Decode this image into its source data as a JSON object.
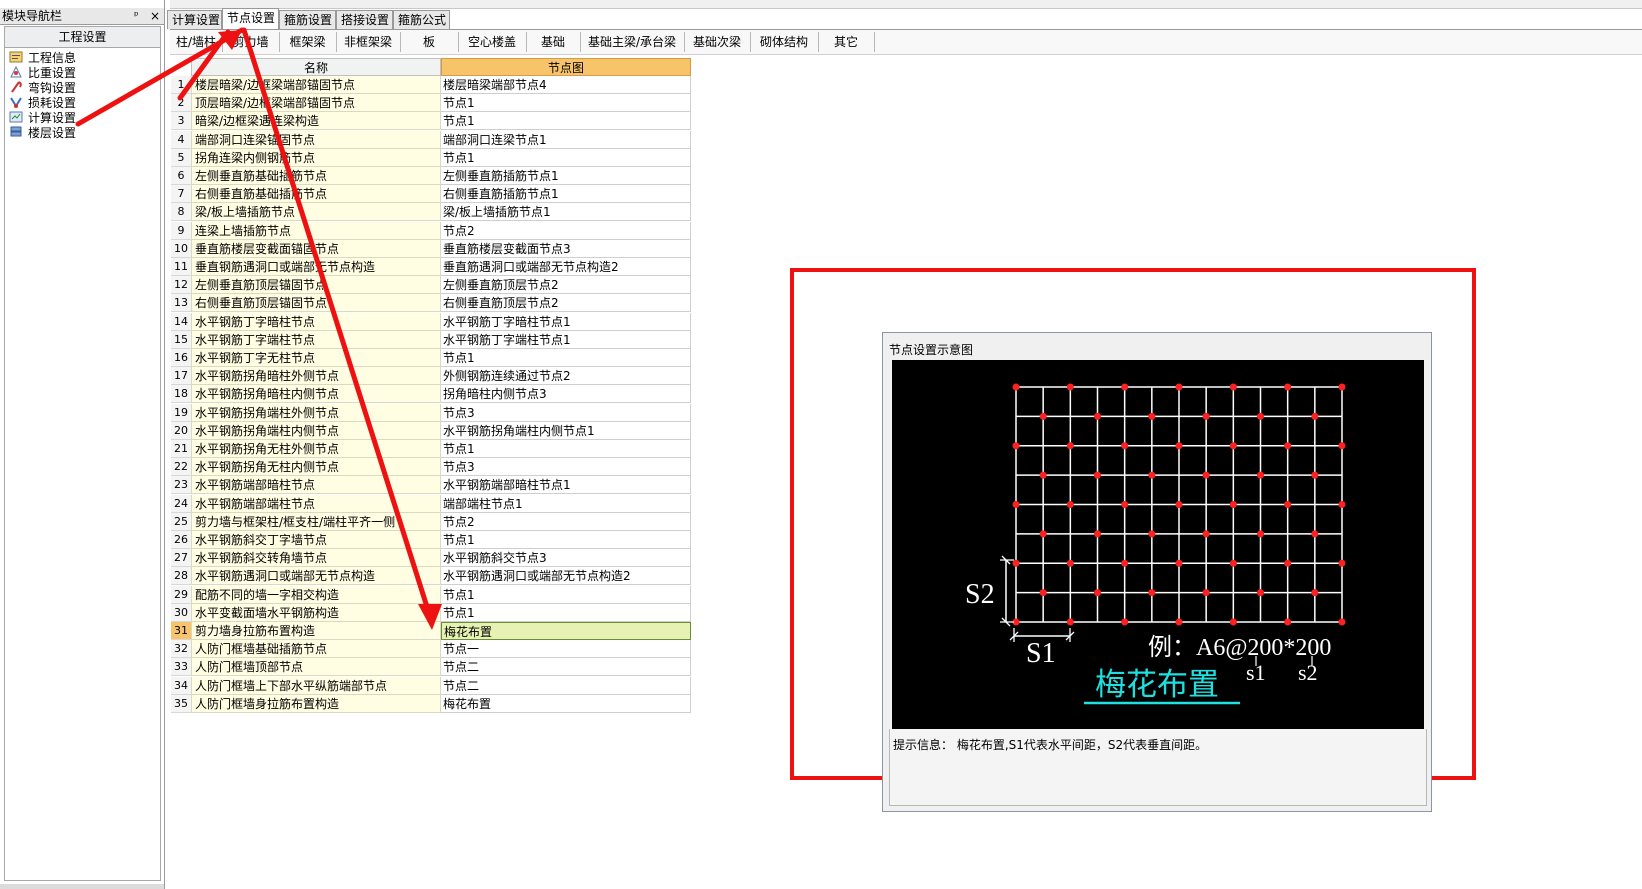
{
  "nav": {
    "title": "模块导航栏",
    "pin": "ᵖ",
    "close": "×",
    "group": "工程设置",
    "items": [
      {
        "label": "工程信息",
        "icon": "info-icon"
      },
      {
        "label": "比重设置",
        "icon": "weight-icon"
      },
      {
        "label": "弯钩设置",
        "icon": "hook-icon"
      },
      {
        "label": "损耗设置",
        "icon": "loss-icon"
      },
      {
        "label": "计算设置",
        "icon": "calc-icon"
      },
      {
        "label": "楼层设置",
        "icon": "floor-icon"
      }
    ]
  },
  "tabs": [
    "计算设置",
    "节点设置",
    "箍筋设置",
    "搭接设置",
    "箍筋公式"
  ],
  "active_tab": "节点设置",
  "subtabs": [
    "柱/墙柱",
    "剪力墙",
    "框架梁",
    "非框架梁",
    "板",
    "空心楼盖",
    "基础",
    "基础主梁/承台梁",
    "基础次梁",
    "砌体结构",
    "其它"
  ],
  "grid": {
    "headers": {
      "name": "名称",
      "node": "节点图"
    },
    "rows": [
      {
        "n": "1",
        "name": "楼层暗梁/边框梁端部锚固节点",
        "node": "楼层暗梁端部节点4"
      },
      {
        "n": "2",
        "name": "顶层暗梁/边框梁端部锚固节点",
        "node": "节点1"
      },
      {
        "n": "3",
        "name": "暗梁/边框梁遇连梁构造",
        "node": "节点1"
      },
      {
        "n": "4",
        "name": "端部洞口连梁锚固节点",
        "node": "端部洞口连梁节点1"
      },
      {
        "n": "5",
        "name": "拐角连梁内侧钢筋节点",
        "node": "节点1"
      },
      {
        "n": "6",
        "name": "左侧垂直筋基础插筋节点",
        "node": "左侧垂直筋插筋节点1"
      },
      {
        "n": "7",
        "name": "右侧垂直筋基础插筋节点",
        "node": "右侧垂直筋插筋节点1"
      },
      {
        "n": "8",
        "name": "梁/板上墙插筋节点",
        "node": "梁/板上墙插筋节点1"
      },
      {
        "n": "9",
        "name": "连梁上墙插筋节点",
        "node": "节点2"
      },
      {
        "n": "10",
        "name": "垂直筋楼层变截面锚固节点",
        "node": "垂直筋楼层变截面节点3"
      },
      {
        "n": "11",
        "name": "垂直钢筋遇洞口或端部无节点构造",
        "node": "垂直筋遇洞口或端部无节点构造2"
      },
      {
        "n": "12",
        "name": "左侧垂直筋顶层锚固节点",
        "node": "左侧垂直筋顶层节点2"
      },
      {
        "n": "13",
        "name": "右侧垂直筋顶层锚固节点",
        "node": "右侧垂直筋顶层节点2"
      },
      {
        "n": "14",
        "name": "水平钢筋丁字暗柱节点",
        "node": "水平钢筋丁字暗柱节点1"
      },
      {
        "n": "15",
        "name": "水平钢筋丁字端柱节点",
        "node": "水平钢筋丁字端柱节点1"
      },
      {
        "n": "16",
        "name": "水平钢筋丁字无柱节点",
        "node": "节点1"
      },
      {
        "n": "17",
        "name": "水平钢筋拐角暗柱外侧节点",
        "node": "外侧钢筋连续通过节点2"
      },
      {
        "n": "18",
        "name": "水平钢筋拐角暗柱内侧节点",
        "node": "拐角暗柱内侧节点3"
      },
      {
        "n": "19",
        "name": "水平钢筋拐角端柱外侧节点",
        "node": "节点3"
      },
      {
        "n": "20",
        "name": "水平钢筋拐角端柱内侧节点",
        "node": "水平钢筋拐角端柱内侧节点1"
      },
      {
        "n": "21",
        "name": "水平钢筋拐角无柱外侧节点",
        "node": "节点1"
      },
      {
        "n": "22",
        "name": "水平钢筋拐角无柱内侧节点",
        "node": "节点3"
      },
      {
        "n": "23",
        "name": "水平钢筋端部暗柱节点",
        "node": "水平钢筋端部暗柱节点1"
      },
      {
        "n": "24",
        "name": "水平钢筋端部端柱节点",
        "node": "端部端柱节点1"
      },
      {
        "n": "25",
        "name": "剪力墙与框架柱/框支柱/端柱平齐一侧",
        "node": "节点2"
      },
      {
        "n": "26",
        "name": "水平钢筋斜交丁字墙节点",
        "node": "节点1"
      },
      {
        "n": "27",
        "name": "水平钢筋斜交转角墙节点",
        "node": "水平钢筋斜交节点3"
      },
      {
        "n": "28",
        "name": "水平钢筋遇洞口或端部无节点构造",
        "node": "水平钢筋遇洞口或端部无节点构造2"
      },
      {
        "n": "29",
        "name": "配筋不同的墙一字相交构造",
        "node": "节点1"
      },
      {
        "n": "30",
        "name": "水平变截面墙水平钢筋构造",
        "node": "节点1"
      },
      {
        "n": "31",
        "name": "剪力墙身拉筋布置构造",
        "node": "梅花布置"
      },
      {
        "n": "32",
        "name": "人防门框墙基础插筋节点",
        "node": "节点一"
      },
      {
        "n": "33",
        "name": "人防门框墙顶部节点",
        "node": "节点二"
      },
      {
        "n": "34",
        "name": "人防门框墙上下部水平纵筋端部节点",
        "node": "节点二"
      },
      {
        "n": "35",
        "name": "人防门框墙身拉筋布置构造",
        "node": "梅花布置"
      }
    ],
    "selected_row": "31"
  },
  "panel": {
    "title": "节点设置示意图",
    "diagram": {
      "s2_label": "S2",
      "s1_label": "S1",
      "example": "例：A6@200*200",
      "s1_small": "s1",
      "s2_small": "s2",
      "pattern_label": "梅花布置"
    },
    "hint": "提示信息：  梅花布置,S1代表水平间距，S2代表垂直间距。"
  },
  "colors": {
    "annotation": "#ee1111",
    "header_node": "#f7c36b",
    "name_cell": "#fffde2",
    "selected_cell": "#e6f2b3",
    "pattern_label": "#1ee0e0"
  }
}
